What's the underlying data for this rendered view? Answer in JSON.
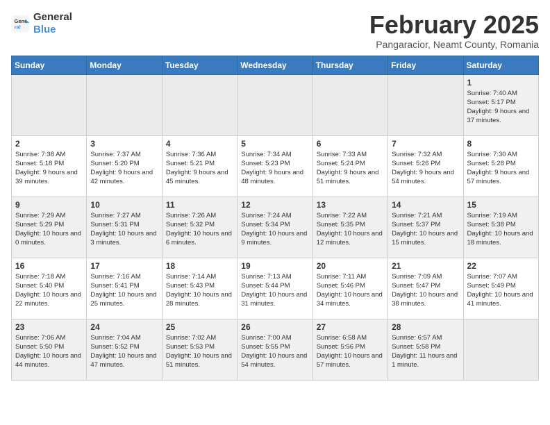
{
  "logo": {
    "general": "General",
    "blue": "Blue"
  },
  "header": {
    "title": "February 2025",
    "subtitle": "Pangaracior, Neamt County, Romania"
  },
  "weekdays": [
    "Sunday",
    "Monday",
    "Tuesday",
    "Wednesday",
    "Thursday",
    "Friday",
    "Saturday"
  ],
  "weeks": [
    [
      {
        "day": "",
        "info": ""
      },
      {
        "day": "",
        "info": ""
      },
      {
        "day": "",
        "info": ""
      },
      {
        "day": "",
        "info": ""
      },
      {
        "day": "",
        "info": ""
      },
      {
        "day": "",
        "info": ""
      },
      {
        "day": "1",
        "info": "Sunrise: 7:40 AM\nSunset: 5:17 PM\nDaylight: 9 hours and 37 minutes."
      }
    ],
    [
      {
        "day": "2",
        "info": "Sunrise: 7:38 AM\nSunset: 5:18 PM\nDaylight: 9 hours and 39 minutes."
      },
      {
        "day": "3",
        "info": "Sunrise: 7:37 AM\nSunset: 5:20 PM\nDaylight: 9 hours and 42 minutes."
      },
      {
        "day": "4",
        "info": "Sunrise: 7:36 AM\nSunset: 5:21 PM\nDaylight: 9 hours and 45 minutes."
      },
      {
        "day": "5",
        "info": "Sunrise: 7:34 AM\nSunset: 5:23 PM\nDaylight: 9 hours and 48 minutes."
      },
      {
        "day": "6",
        "info": "Sunrise: 7:33 AM\nSunset: 5:24 PM\nDaylight: 9 hours and 51 minutes."
      },
      {
        "day": "7",
        "info": "Sunrise: 7:32 AM\nSunset: 5:26 PM\nDaylight: 9 hours and 54 minutes."
      },
      {
        "day": "8",
        "info": "Sunrise: 7:30 AM\nSunset: 5:28 PM\nDaylight: 9 hours and 57 minutes."
      }
    ],
    [
      {
        "day": "9",
        "info": "Sunrise: 7:29 AM\nSunset: 5:29 PM\nDaylight: 10 hours and 0 minutes."
      },
      {
        "day": "10",
        "info": "Sunrise: 7:27 AM\nSunset: 5:31 PM\nDaylight: 10 hours and 3 minutes."
      },
      {
        "day": "11",
        "info": "Sunrise: 7:26 AM\nSunset: 5:32 PM\nDaylight: 10 hours and 6 minutes."
      },
      {
        "day": "12",
        "info": "Sunrise: 7:24 AM\nSunset: 5:34 PM\nDaylight: 10 hours and 9 minutes."
      },
      {
        "day": "13",
        "info": "Sunrise: 7:22 AM\nSunset: 5:35 PM\nDaylight: 10 hours and 12 minutes."
      },
      {
        "day": "14",
        "info": "Sunrise: 7:21 AM\nSunset: 5:37 PM\nDaylight: 10 hours and 15 minutes."
      },
      {
        "day": "15",
        "info": "Sunrise: 7:19 AM\nSunset: 5:38 PM\nDaylight: 10 hours and 18 minutes."
      }
    ],
    [
      {
        "day": "16",
        "info": "Sunrise: 7:18 AM\nSunset: 5:40 PM\nDaylight: 10 hours and 22 minutes."
      },
      {
        "day": "17",
        "info": "Sunrise: 7:16 AM\nSunset: 5:41 PM\nDaylight: 10 hours and 25 minutes."
      },
      {
        "day": "18",
        "info": "Sunrise: 7:14 AM\nSunset: 5:43 PM\nDaylight: 10 hours and 28 minutes."
      },
      {
        "day": "19",
        "info": "Sunrise: 7:13 AM\nSunset: 5:44 PM\nDaylight: 10 hours and 31 minutes."
      },
      {
        "day": "20",
        "info": "Sunrise: 7:11 AM\nSunset: 5:46 PM\nDaylight: 10 hours and 34 minutes."
      },
      {
        "day": "21",
        "info": "Sunrise: 7:09 AM\nSunset: 5:47 PM\nDaylight: 10 hours and 38 minutes."
      },
      {
        "day": "22",
        "info": "Sunrise: 7:07 AM\nSunset: 5:49 PM\nDaylight: 10 hours and 41 minutes."
      }
    ],
    [
      {
        "day": "23",
        "info": "Sunrise: 7:06 AM\nSunset: 5:50 PM\nDaylight: 10 hours and 44 minutes."
      },
      {
        "day": "24",
        "info": "Sunrise: 7:04 AM\nSunset: 5:52 PM\nDaylight: 10 hours and 47 minutes."
      },
      {
        "day": "25",
        "info": "Sunrise: 7:02 AM\nSunset: 5:53 PM\nDaylight: 10 hours and 51 minutes."
      },
      {
        "day": "26",
        "info": "Sunrise: 7:00 AM\nSunset: 5:55 PM\nDaylight: 10 hours and 54 minutes."
      },
      {
        "day": "27",
        "info": "Sunrise: 6:58 AM\nSunset: 5:56 PM\nDaylight: 10 hours and 57 minutes."
      },
      {
        "day": "28",
        "info": "Sunrise: 6:57 AM\nSunset: 5:58 PM\nDaylight: 11 hours and 1 minute."
      },
      {
        "day": "",
        "info": ""
      }
    ]
  ]
}
